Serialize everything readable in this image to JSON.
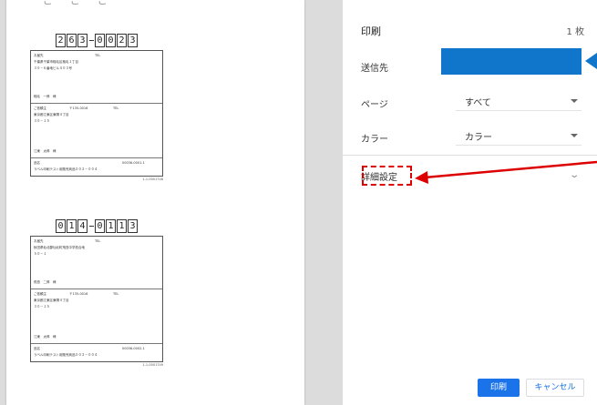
{
  "preview": {
    "top_fragment": "ご　ご　ご",
    "labels": [
      {
        "zip_left": [
          "2",
          "6",
          "3"
        ],
        "zip_right": [
          "0",
          "0",
          "2",
          "3"
        ],
        "to_label": "お届先",
        "to_tel": "TEL",
        "to_addr1": "千葉県千葉市稲毛区稲毛１丁目",
        "to_addr2": "３０－６番地ビル４０３号",
        "to_name": "稲毛　一郎　様",
        "from_label": "ご依頼主",
        "from_zip": "〒135-0016",
        "from_tel": "TEL",
        "from_addr1": "東京都江東区東陽４丁目",
        "from_addr2": "３０－１５",
        "from_name": "江東　太郎　様",
        "item_label": "品名",
        "item_code": "00036-0001-1",
        "item_desc": "ラベル印刷テスト用販売商品００２－００４",
        "foot": "1-1-0001748"
      },
      {
        "zip_left": [
          "0",
          "1",
          "4"
        ],
        "zip_right": [
          "0",
          "1",
          "1",
          "3"
        ],
        "to_label": "お届先",
        "to_tel": "TEL",
        "to_addr1": "秋田県仙北郡仙北町飛島中学校合地",
        "to_addr2": "５０－１",
        "to_name": "飛島　二郎　様",
        "from_label": "ご依頼主",
        "from_zip": "〒135-0016",
        "from_tel": "TEL",
        "from_addr1": "東京都江東区東陽４丁目",
        "from_addr2": "３０－１５",
        "from_name": "江東　太郎　様",
        "item_label": "品名",
        "item_code": "00036-0002-1",
        "item_desc": "ラベル印刷テスト用販売商品００２－００４",
        "foot": "1-1-0001749"
      }
    ]
  },
  "panel": {
    "title": "印刷",
    "sheet_count": "1 枚",
    "destination_label": "送信先",
    "pages_label": "ページ",
    "pages_value": "すべて",
    "color_label": "カラー",
    "color_value": "カラー",
    "advanced_label": "詳細設定",
    "print_button": "印刷",
    "cancel_button": "キャンセル"
  },
  "colors": {
    "accent": "#1a73e8",
    "destination_fill": "#0f76cc",
    "annotation": "#dd0000",
    "annotation_arrow_blue": "#0f76cc"
  }
}
